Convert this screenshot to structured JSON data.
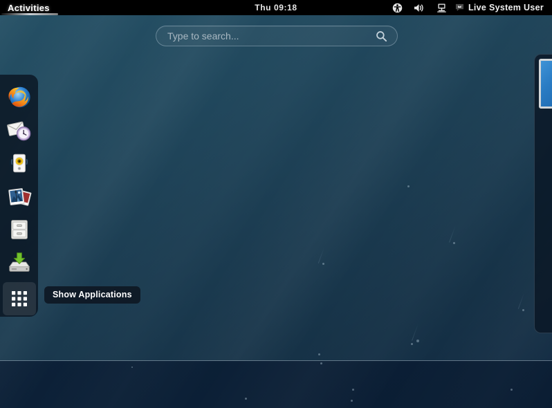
{
  "topbar": {
    "activities_label": "Activities",
    "clock": "Thu 09:18",
    "status_icons": [
      {
        "name": "universal-access-icon",
        "title": "Accessibility"
      },
      {
        "name": "volume-icon",
        "title": "Volume"
      },
      {
        "name": "network-workstation-icon",
        "title": "Network"
      }
    ],
    "user_menu": {
      "message_icon": "chat-message-icon",
      "user_name": "Live System User"
    }
  },
  "search": {
    "placeholder": "Type to search...",
    "value": "",
    "icon": "search-icon"
  },
  "dash": {
    "items": [
      {
        "label": "Firefox Web Browser",
        "icon": "firefox-icon",
        "selected": false
      },
      {
        "label": "Evolution Mail",
        "icon": "evolution-mail-icon",
        "selected": false
      },
      {
        "label": "Rhythmbox Music Player",
        "icon": "rhythmbox-icon",
        "selected": false
      },
      {
        "label": "Shotwell Photo Manager",
        "icon": "shotwell-photos-icon",
        "selected": false
      },
      {
        "label": "Files",
        "icon": "files-cabinet-icon",
        "selected": false
      },
      {
        "label": "Install to Hard Drive",
        "icon": "install-to-disk-icon",
        "selected": false
      }
    ],
    "show_applications": {
      "label": "Show Applications",
      "icon": "app-grid-icon",
      "selected": true
    }
  },
  "tooltip": {
    "text": "Show Applications"
  },
  "workspaces": {
    "thumbnails": [
      {
        "label": "Workspace 1",
        "active": true,
        "has_window": true
      }
    ]
  },
  "colors": {
    "topbar_bg": "#000000",
    "overview_bg": "#1c3d52",
    "overview_bg_lower": "#0a1d33",
    "dash_bg": "rgba(10,20,32,0.80)",
    "accent_text": "#ffffff",
    "placeholder_text": "#a9b8c2",
    "window_preview": "#2a7cc4"
  }
}
